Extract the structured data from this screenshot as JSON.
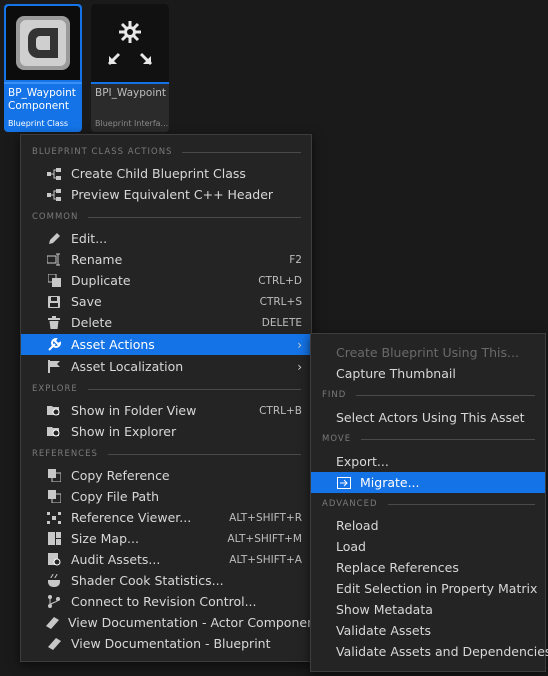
{
  "tiles": [
    {
      "name": "BP_Waypoint\nComponent",
      "type": "Blueprint Class"
    },
    {
      "name": "BPI_Waypoint",
      "type": "Blueprint Interfa..."
    }
  ],
  "main_menu": {
    "sections": {
      "blueprint_class_actions": "BLUEPRINT CLASS ACTIONS",
      "common": "COMMON",
      "explore": "EXPLORE",
      "references": "REFERENCES"
    },
    "items": {
      "create_child": "Create Child Blueprint Class",
      "preview_cpp": "Preview Equivalent C++ Header",
      "edit": "Edit...",
      "rename": "Rename",
      "rename_sc": "F2",
      "duplicate": "Duplicate",
      "duplicate_sc": "CTRL+D",
      "save": "Save",
      "save_sc": "CTRL+S",
      "delete": "Delete",
      "delete_sc": "DELETE",
      "asset_actions": "Asset Actions",
      "asset_localization": "Asset Localization",
      "show_folder": "Show in Folder View",
      "show_folder_sc": "CTRL+B",
      "show_explorer": "Show in Explorer",
      "copy_reference": "Copy Reference",
      "copy_file_path": "Copy File Path",
      "reference_viewer": "Reference Viewer...",
      "reference_viewer_sc": "ALT+SHIFT+R",
      "size_map": "Size Map...",
      "size_map_sc": "ALT+SHIFT+M",
      "audit_assets": "Audit Assets...",
      "audit_assets_sc": "ALT+SHIFT+A",
      "shader_cook": "Shader Cook Statistics...",
      "revision_control": "Connect to Revision Control...",
      "doc_actor": "View Documentation - Actor Component",
      "doc_blueprint": "View Documentation - Blueprint"
    }
  },
  "sub_menu": {
    "sections": {
      "find": "FIND",
      "move": "MOVE",
      "advanced": "ADVANCED"
    },
    "items": {
      "create_blueprint": "Create Blueprint Using This...",
      "capture_thumbnail": "Capture Thumbnail",
      "select_actors": "Select Actors Using This Asset",
      "export": "Export...",
      "migrate": "Migrate...",
      "reload": "Reload",
      "load": "Load",
      "replace_references": "Replace References",
      "edit_selection": "Edit Selection in Property Matrix",
      "show_metadata": "Show Metadata",
      "validate_assets": "Validate Assets",
      "validate_deps": "Validate Assets and Dependencies"
    }
  },
  "colors": {
    "accent": "#1473e6",
    "menu_bg": "#242424"
  }
}
